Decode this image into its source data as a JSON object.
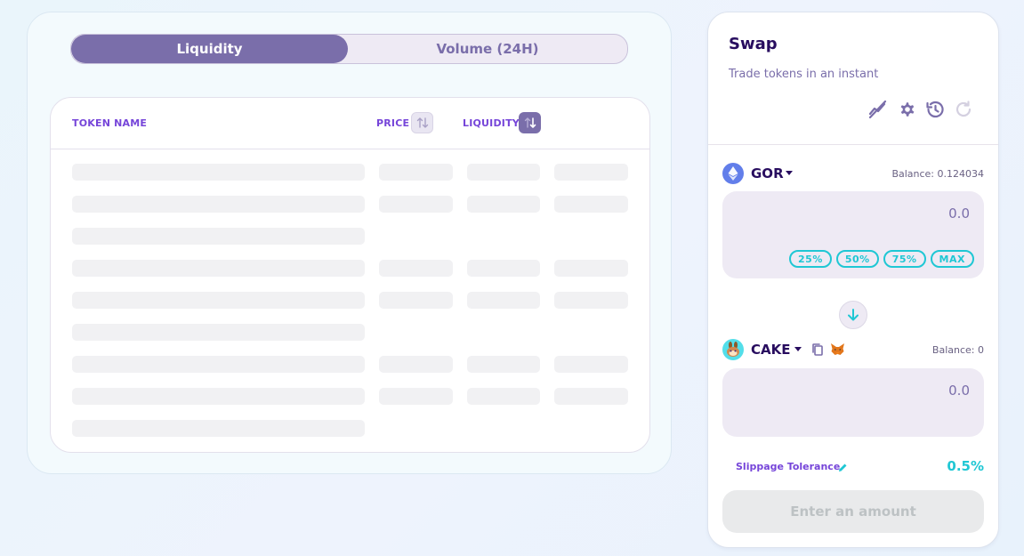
{
  "tabs": {
    "liquidity_label": "Liquidity",
    "volume_label": "Volume (24H)"
  },
  "table": {
    "col_token": "TOKEN NAME",
    "col_price": "PRICE",
    "col_liquidity": "LIQUIDITY"
  },
  "swap": {
    "title": "Swap",
    "subtitle": "Trade tokens in an instant",
    "icons": [
      "chart-off-icon",
      "gear-icon",
      "history-icon",
      "refresh-icon"
    ],
    "from": {
      "symbol": "GOR",
      "balance": "Balance: 0.124034",
      "amount": "0.0",
      "percent_buttons": [
        "25%",
        "50%",
        "75%",
        "MAX"
      ]
    },
    "to": {
      "symbol": "CAKE",
      "balance": "Balance: 0",
      "amount": "0.0"
    },
    "slippage_label": "Slippage Tolerance",
    "slippage_value": "0.5%",
    "submit_label": "Enter an amount"
  },
  "colors": {
    "primary": "#7a6eaa",
    "secondary": "#7645d9",
    "accent": "#1fc7d4",
    "text": "#280d5f"
  }
}
